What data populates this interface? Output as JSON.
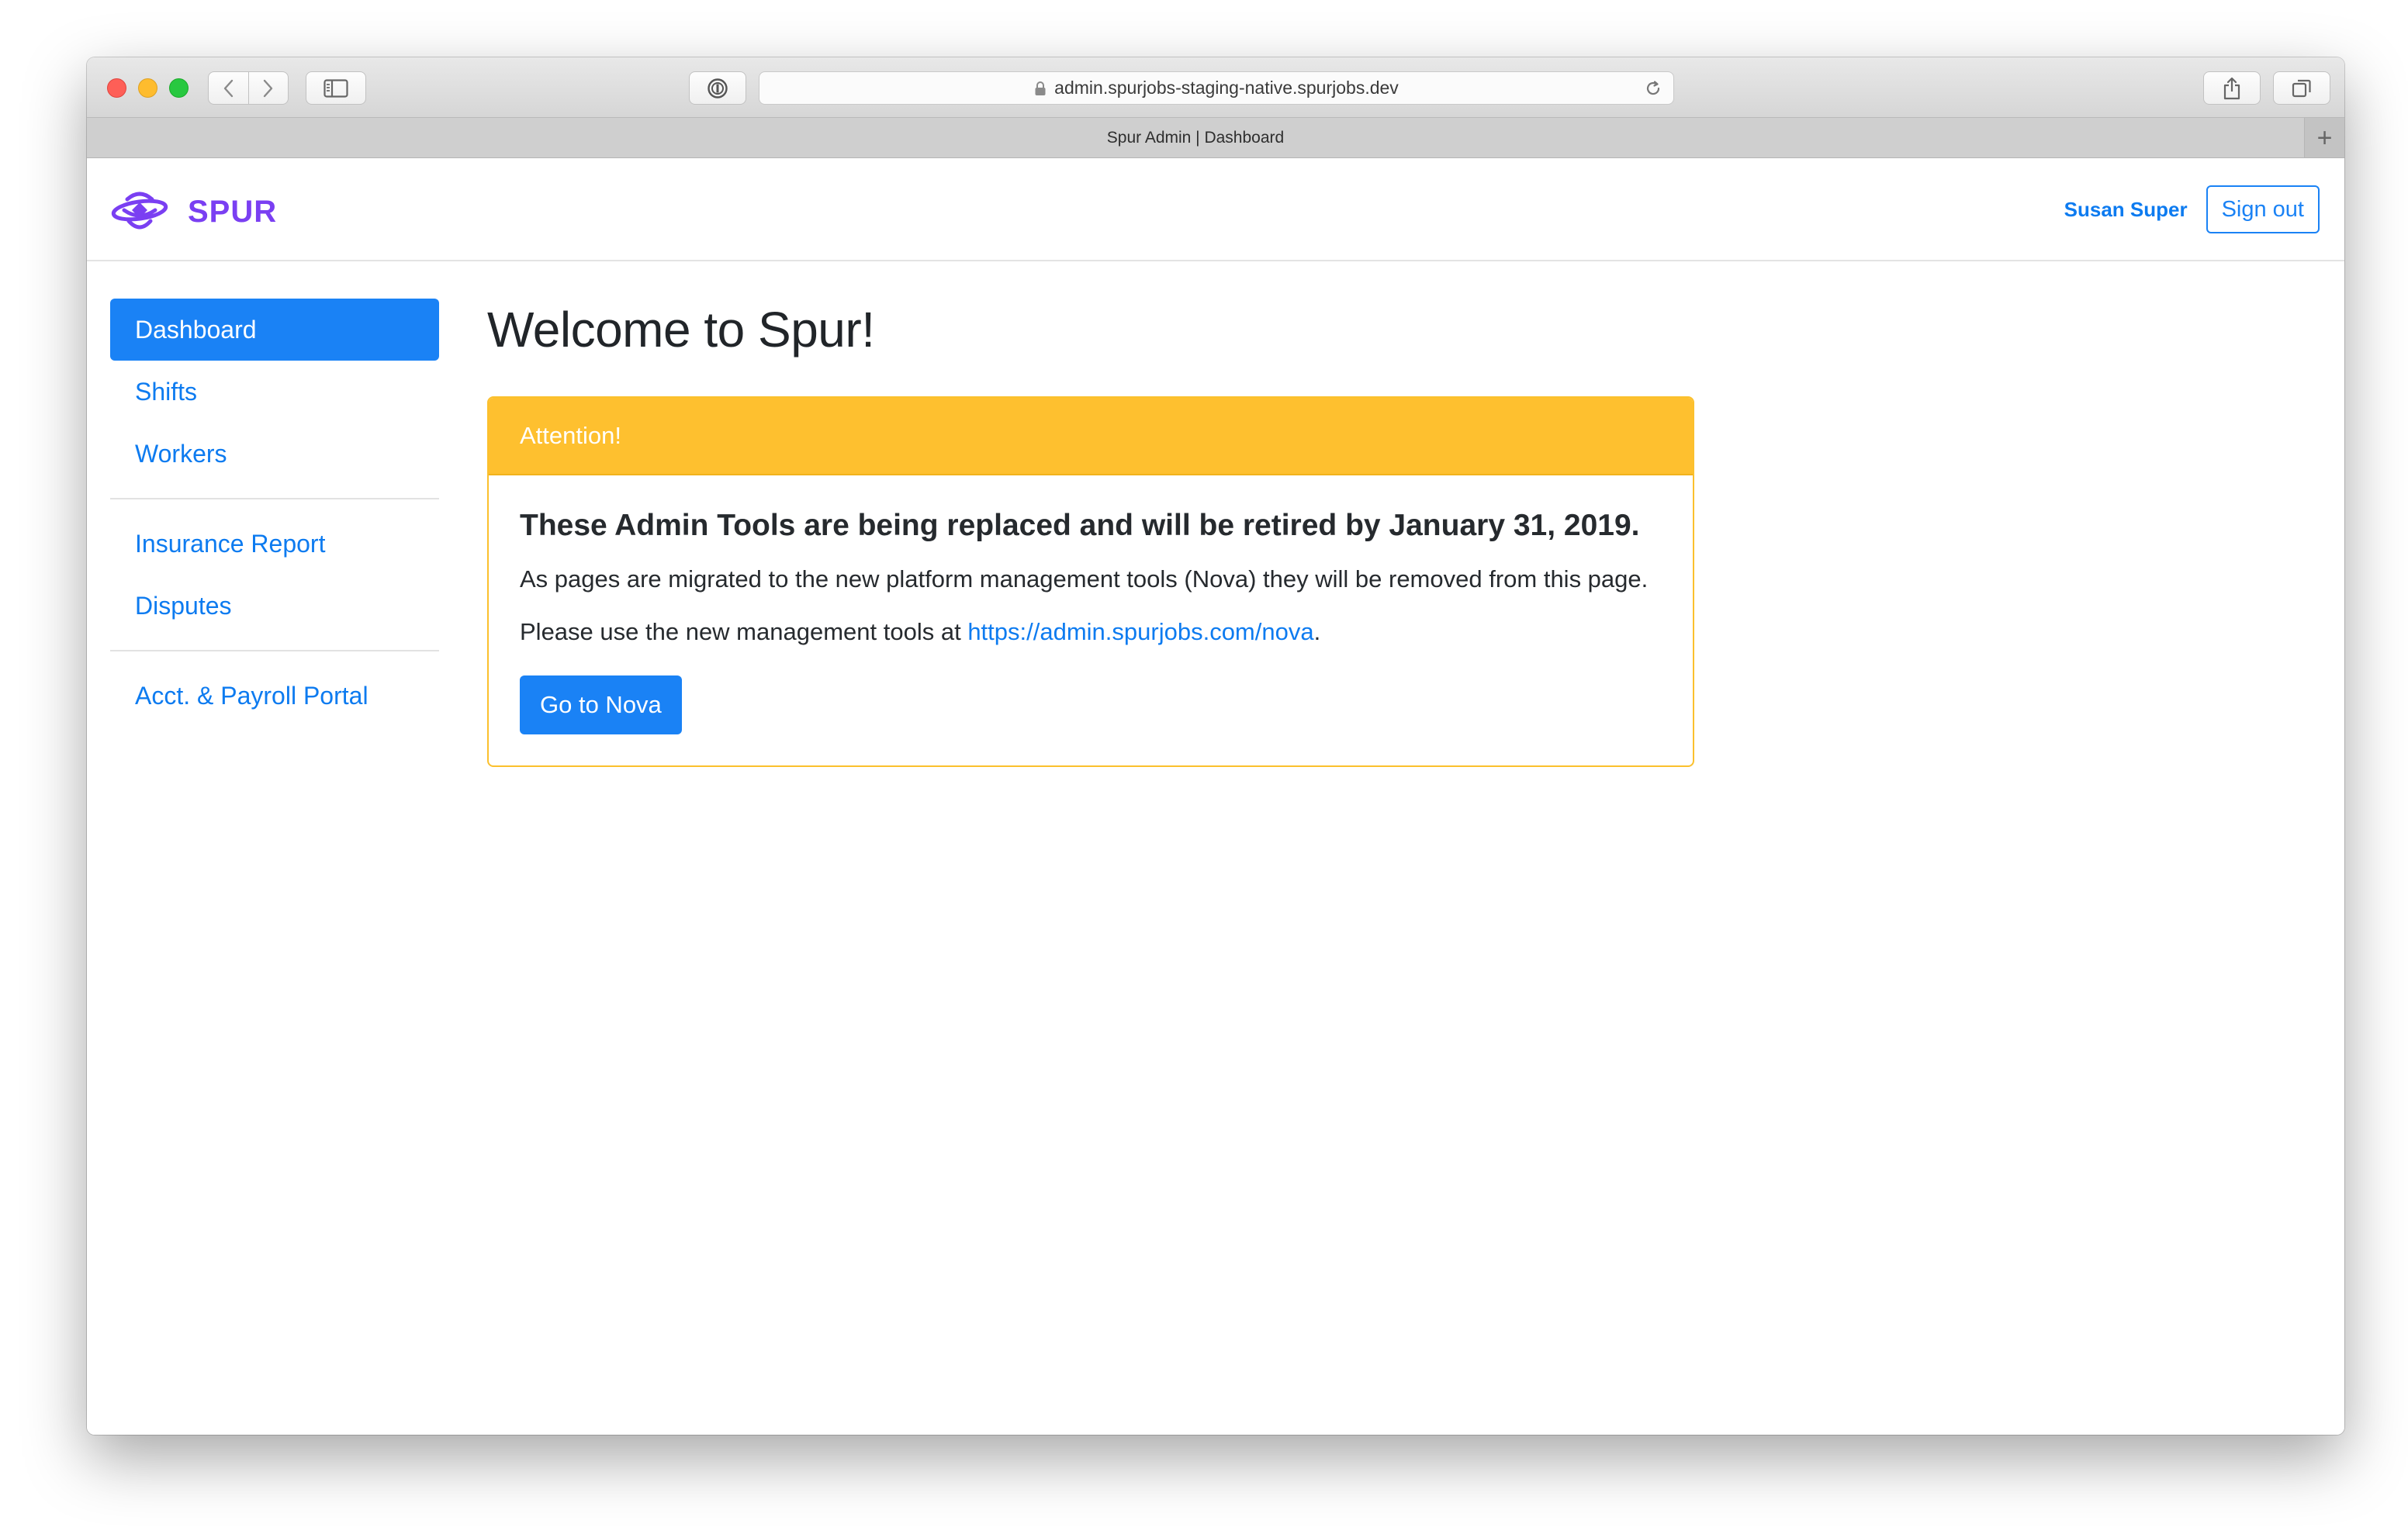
{
  "browser": {
    "url": "admin.spurjobs-staging-native.spurjobs.dev",
    "tab_title": "Spur Admin | Dashboard",
    "new_tab_glyph": "+"
  },
  "header": {
    "brand": "SPUR",
    "brand_color": "#7a3ff2",
    "user_name": "Susan Super",
    "signout_label": "Sign out"
  },
  "sidebar": {
    "groups": [
      {
        "items": [
          {
            "label": "Dashboard",
            "active": true
          },
          {
            "label": "Shifts"
          },
          {
            "label": "Workers"
          }
        ]
      },
      {
        "items": [
          {
            "label": "Insurance Report"
          },
          {
            "label": "Disputes"
          }
        ]
      },
      {
        "items": [
          {
            "label": "Acct. & Payroll Portal"
          }
        ]
      }
    ]
  },
  "main": {
    "title": "Welcome to Spur!",
    "card": {
      "header": "Attention!",
      "title": "These Admin Tools are being replaced and will be retired by January 31, 2019.",
      "paragraph1": "As pages are migrated to the new platform management tools (Nova) they will be removed from this page.",
      "paragraph2_prefix": "Please use the new management tools at ",
      "paragraph2_link": "https://admin.spurjobs.com/nova",
      "paragraph2_suffix": ".",
      "button_label": "Go to Nova",
      "accent_color": "#fec02f"
    }
  },
  "colors": {
    "primary": "#1a82f5",
    "link": "#0d7bf0",
    "warning": "#fec02f"
  }
}
